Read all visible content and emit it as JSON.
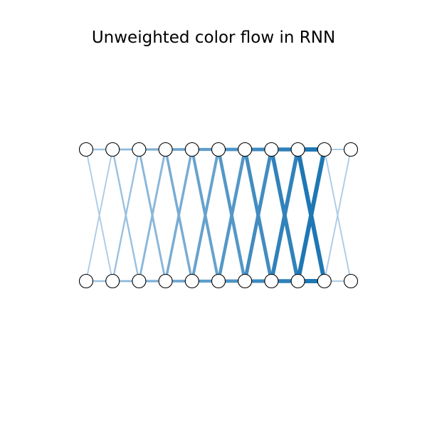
{
  "title": "Unweighted color flow in RNN",
  "colors": {
    "node_fill": "#ffffff",
    "node_stroke": "#000000",
    "edge_light": "#c6dbef",
    "edge_dark": "#1f77b4"
  },
  "graph": {
    "nodes_per_row": 11,
    "rows": [
      "top",
      "bottom"
    ],
    "edges_note_free": true
  }
}
